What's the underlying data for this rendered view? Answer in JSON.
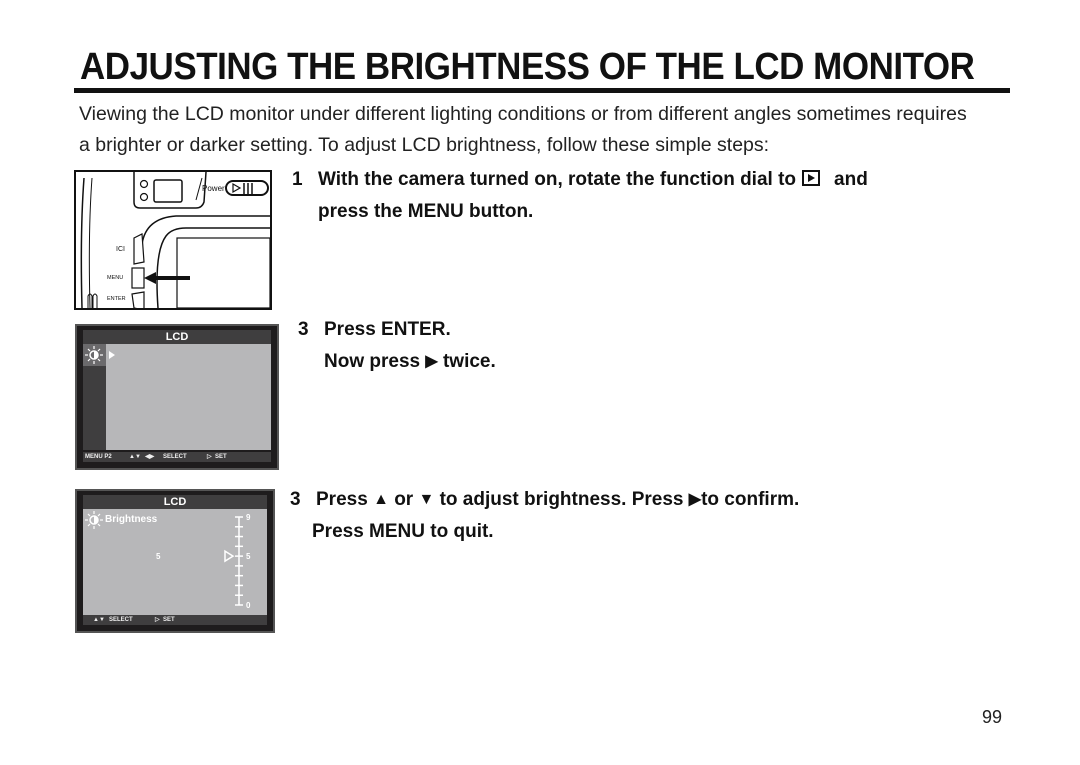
{
  "page": {
    "title": "ADJUSTING THE BRIGHTNESS OF THE LCD MONITOR",
    "intro_line1": "Viewing the LCD monitor under different lighting conditions or from different angles sometimes requires",
    "intro_line2": "a brighter or darker setting. To adjust LCD brightness, follow these simple steps:",
    "page_number": "99"
  },
  "camera_figure": {
    "power_label": "Power",
    "buttons": [
      "ICI",
      "MENU",
      "ENTER"
    ]
  },
  "steps": [
    {
      "number": "1",
      "line1_a": "With the camera turned on, rotate the function dial to",
      "line1_icon": "playback-mode-icon",
      "line1_b": "and",
      "line2": "press the MENU button."
    },
    {
      "number": "3",
      "line1": "Press ENTER.",
      "line2_a": "Now press",
      "line2_icon": "right-arrow",
      "line2_b": "twice."
    },
    {
      "number": "3",
      "line1_a": "Press",
      "line1_up": "▲",
      "line1_b": "or",
      "line1_down": "▼",
      "line1_c": "to adjust brightness. Press",
      "line1_right": "▶",
      "line1_d": "to confirm.",
      "line2": "Press MENU to quit."
    }
  ],
  "lcd_screen_1": {
    "header": "LCD",
    "footer_menu": "MENU P2",
    "footer_updown": "▲▼",
    "footer_leftright": "◀▶",
    "footer_select": "SELECT",
    "footer_set_icon": "▷",
    "footer_set": "SET"
  },
  "lcd_screen_2": {
    "header": "LCD",
    "item_label": "Brightness",
    "current_value": "5",
    "scale_max": "9",
    "scale_mid": "5",
    "scale_min": "0",
    "brightness_level": 5,
    "brightness_range": [
      0,
      9
    ],
    "footer_updown": "▲▼",
    "footer_select": "SELECT",
    "footer_set_icon": "▷",
    "footer_set": "SET"
  },
  "glyphs": {
    "right": "▶"
  }
}
